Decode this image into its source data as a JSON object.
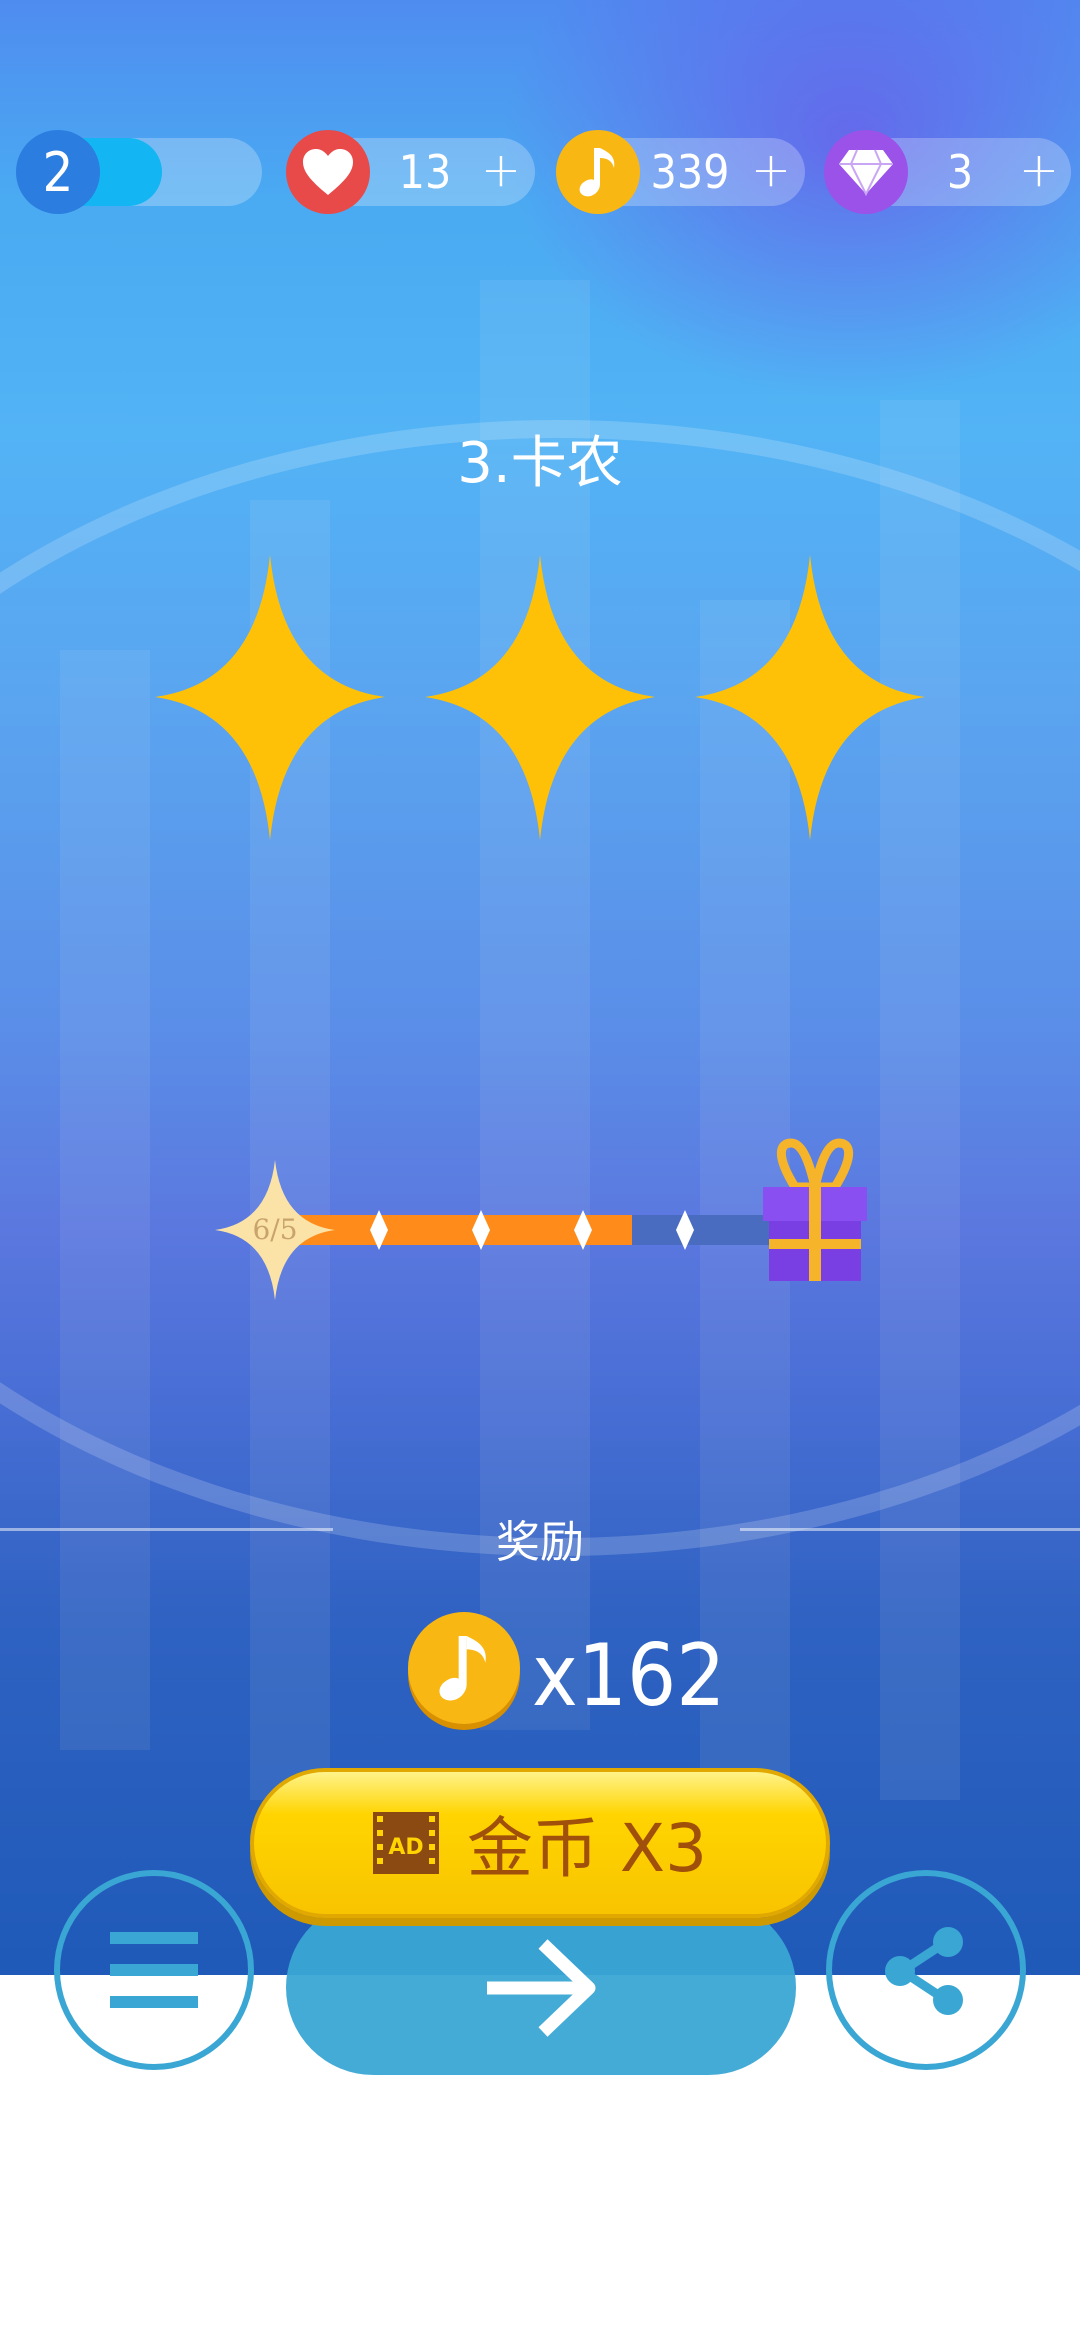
{
  "status_bar": {
    "level": {
      "value": "2",
      "fill_fraction": 0.45
    },
    "lives": {
      "icon": "heart-icon",
      "value": "13",
      "plus": "+"
    },
    "notes": {
      "icon": "music-note-coin-icon",
      "value": "339",
      "plus": "+"
    },
    "gems": {
      "icon": "diamond-icon",
      "value": "3",
      "plus": "+"
    }
  },
  "song": {
    "title": "3.卡农",
    "stars_earned": 3,
    "stars_total": 3
  },
  "progress": {
    "label": "6/5",
    "filled_segments": 3,
    "total_segments": 4,
    "reward_icon": "gift-box-icon"
  },
  "reward": {
    "label": "奖励",
    "icon": "music-note-coin-icon",
    "amount": "x162"
  },
  "ad_button": {
    "icon": "ad-video-icon",
    "label": "金币 X3"
  },
  "nav": {
    "menu_icon": "menu-icon",
    "next_icon": "arrow-right-icon",
    "share_icon": "share-icon"
  },
  "colors": {
    "star": "#FFC107",
    "progress_fill": "#FF8C1A",
    "ad_button": "#FFD400",
    "nav_blue": "#3AA6D4",
    "coin": "#F9B714"
  }
}
